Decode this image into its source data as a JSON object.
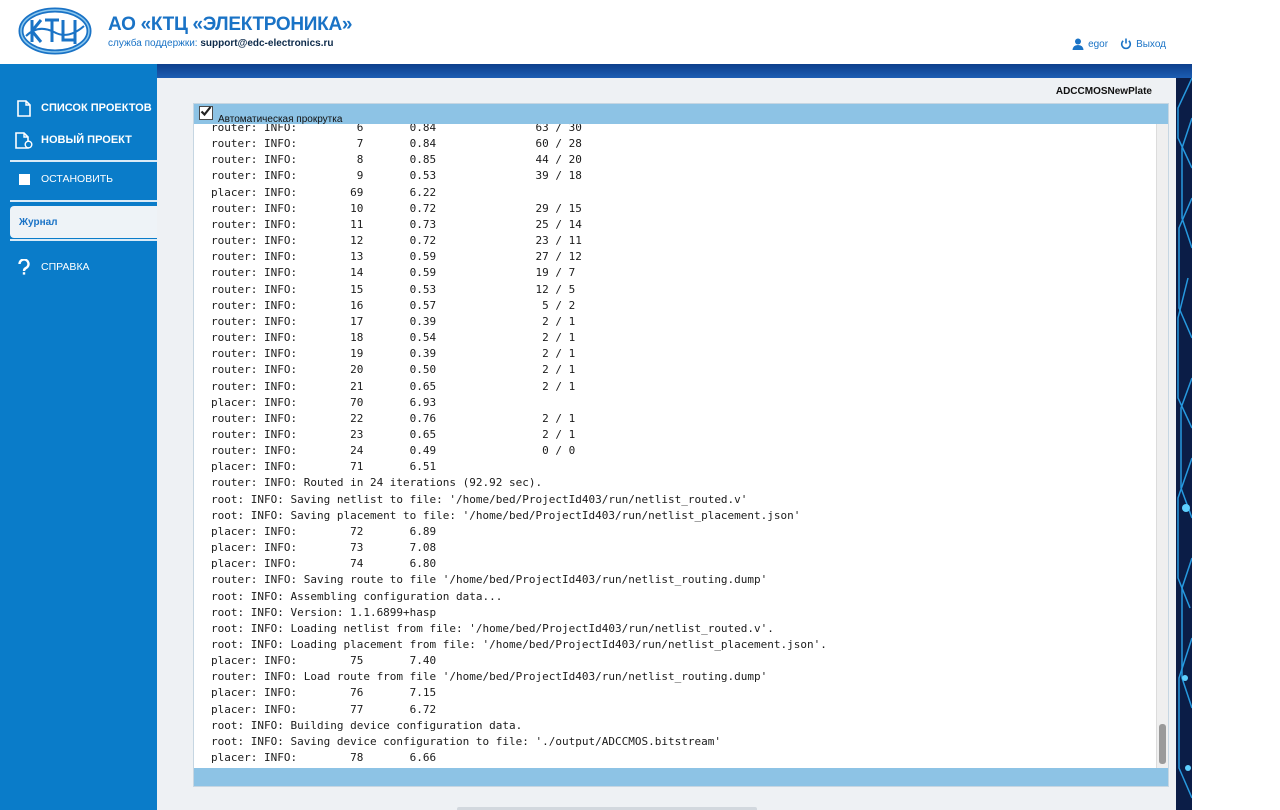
{
  "header": {
    "logo_icon": "ktc-logo-icon",
    "company_name": "АО «КТЦ «ЭЛЕКТРОНИКА»",
    "support_label": "служба поддержки:",
    "support_email": "support@edc-electronics.ru",
    "user_name": "egor",
    "logout_label": "Выход"
  },
  "sidebar": {
    "items": [
      {
        "label": "СПИСОК ПРОЕКТОВ",
        "icon": "document-icon"
      },
      {
        "label": "НОВЫЙ ПРОЕКТ",
        "icon": "new-document-icon"
      },
      {
        "label": "ОСТАНОВИТЬ",
        "icon": "stop-icon"
      },
      {
        "label": "Журнал",
        "icon": "",
        "active": true
      },
      {
        "label": "СПРАВКА",
        "icon": "question-icon"
      }
    ]
  },
  "main": {
    "project_name": "ADCCMOSNewPlate",
    "autoscroll_label": "Автоматическая прокрутка",
    "autoscroll_checked": true,
    "log_lines": [
      "router: INFO:         6       0.84               63 / 30",
      "router: INFO:         7       0.84               60 / 28",
      "router: INFO:         8       0.85               44 / 20",
      "router: INFO:         9       0.53               39 / 18",
      "placer: INFO:        69       6.22",
      "router: INFO:        10       0.72               29 / 15",
      "router: INFO:        11       0.73               25 / 14",
      "router: INFO:        12       0.72               23 / 11",
      "router: INFO:        13       0.59               27 / 12",
      "router: INFO:        14       0.59               19 / 7",
      "router: INFO:        15       0.53               12 / 5",
      "router: INFO:        16       0.57                5 / 2",
      "router: INFO:        17       0.39                2 / 1",
      "router: INFO:        18       0.54                2 / 1",
      "router: INFO:        19       0.39                2 / 1",
      "router: INFO:        20       0.50                2 / 1",
      "router: INFO:        21       0.65                2 / 1",
      "placer: INFO:        70       6.93",
      "router: INFO:        22       0.76                2 / 1",
      "router: INFO:        23       0.65                2 / 1",
      "router: INFO:        24       0.49                0 / 0",
      "placer: INFO:        71       6.51",
      "router: INFO: Routed in 24 iterations (92.92 sec).",
      "root: INFO: Saving netlist to file: '/home/bed/ProjectId403/run/netlist_routed.v'",
      "root: INFO: Saving placement to file: '/home/bed/ProjectId403/run/netlist_placement.json'",
      "placer: INFO:        72       6.89",
      "placer: INFO:        73       7.08",
      "placer: INFO:        74       6.80",
      "router: INFO: Saving route to file '/home/bed/ProjectId403/run/netlist_routing.dump'",
      "root: INFO: Assembling configuration data...",
      "root: INFO: Version: 1.1.6899+hasp",
      "root: INFO: Loading netlist from file: '/home/bed/ProjectId403/run/netlist_routed.v'.",
      "root: INFO: Loading placement from file: '/home/bed/ProjectId403/run/netlist_placement.json'.",
      "placer: INFO:        75       7.40",
      "router: INFO: Load route from file '/home/bed/ProjectId403/run/netlist_routing.dump'",
      "placer: INFO:        76       7.15",
      "placer: INFO:        77       6.72",
      "root: INFO: Building device configuration data.",
      "root: INFO: Saving device configuration to file: './output/ADCCMOS.bitstream'",
      "placer: INFO:        78       6.66"
    ]
  },
  "colors": {
    "brand_blue": "#1a73c6",
    "sidebar_bg": "#0a7cc9",
    "panel_bar": "#8dc3e5",
    "topbar_dark": "#0d3f8c"
  }
}
